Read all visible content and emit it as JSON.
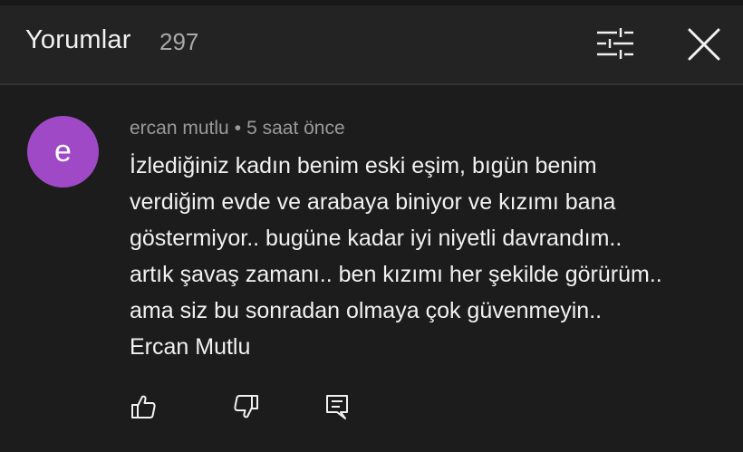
{
  "header": {
    "title": "Yorumlar",
    "count": "297",
    "filter_icon": "sliders-icon",
    "close_icon": "close-icon"
  },
  "comment": {
    "avatar_letter": "e",
    "avatar_color": "#a049c6",
    "author": "ercan mutlu",
    "separator": "•",
    "time": "5 saat önce",
    "lines": [
      "İzlediğiniz kadın benim eski eşim, bıgün benim",
      "verdiğim evde ve arabaya biniyor ve kızımı bana",
      "göstermiyor.. bugüne kadar iyi niyetli davrandım..",
      "artık şavaş zamanı.. ben kızımı her şekilde görürüm..",
      "ama siz bu sonradan olmaya çok güvenmeyin..",
      "Ercan Mutlu"
    ],
    "actions": {
      "like_icon": "thumbs-up-icon",
      "dislike_icon": "thumbs-down-icon",
      "reply_icon": "reply-icon"
    }
  },
  "colors": {
    "background": "#1c1c1c",
    "header_background": "#232323",
    "text_primary": "#f1f1f1",
    "text_secondary": "#9a9a9a"
  }
}
